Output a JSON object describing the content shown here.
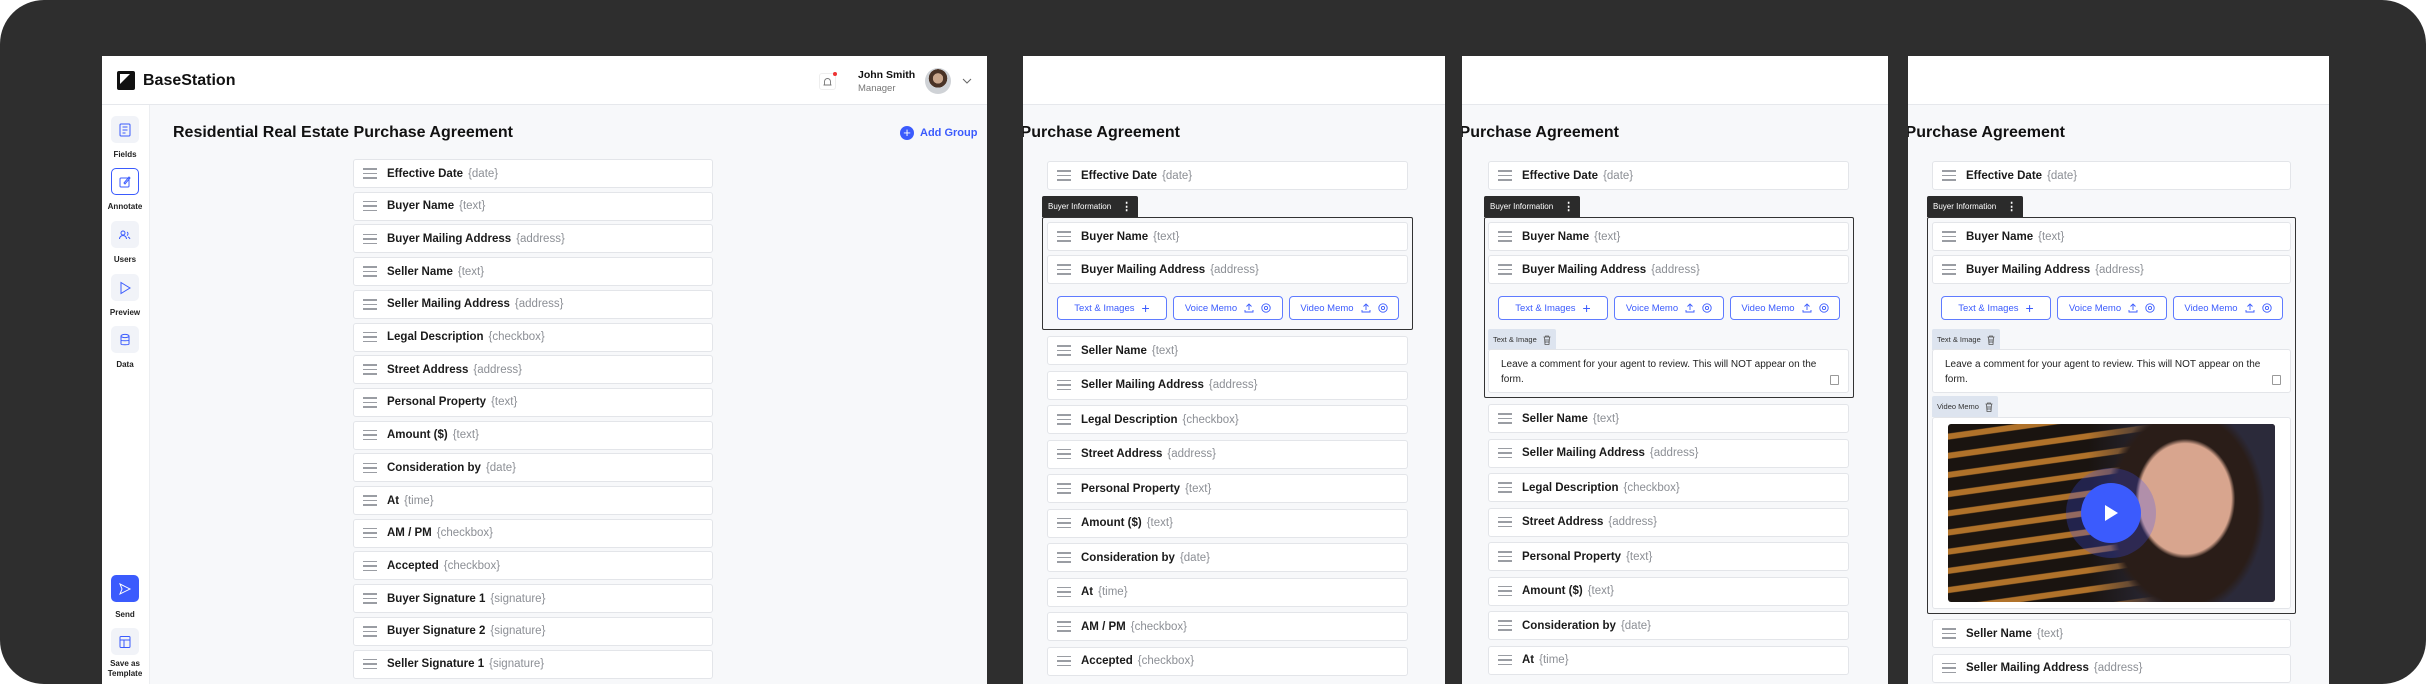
{
  "app": {
    "name": "BaseStation"
  },
  "user": {
    "name": "John Smith",
    "role": "Manager"
  },
  "sidebar": {
    "items": [
      {
        "label": "Fields",
        "icon": "document-icon"
      },
      {
        "label": "Annotate",
        "icon": "edit-icon",
        "selected": true
      },
      {
        "label": "Users",
        "icon": "users-icon"
      },
      {
        "label": "Preview",
        "icon": "play-icon"
      },
      {
        "label": "Data",
        "icon": "database-icon"
      }
    ],
    "send": {
      "label": "Send"
    },
    "template": {
      "label1": "Save as",
      "label2": "Template"
    }
  },
  "page": {
    "title": "Residential Real Estate Purchase Agreement",
    "add_group": "Add Group"
  },
  "fields": [
    {
      "label": "Effective Date",
      "type": "{date}"
    },
    {
      "label": "Buyer Name",
      "type": "{text}"
    },
    {
      "label": "Buyer Mailing Address",
      "type": "{address}"
    },
    {
      "label": "Seller Name",
      "type": "{text}"
    },
    {
      "label": "Seller Mailing Address",
      "type": "{address}"
    },
    {
      "label": "Legal Description",
      "type": "{checkbox}"
    },
    {
      "label": "Street Address",
      "type": "{address}"
    },
    {
      "label": "Personal Property",
      "type": "{text}"
    },
    {
      "label": "Amount ($)",
      "type": "{text}"
    },
    {
      "label": "Consideration by",
      "type": "{date}"
    },
    {
      "label": "At",
      "type": "{time}"
    },
    {
      "label": "AM / PM",
      "type": "{checkbox}"
    },
    {
      "label": "Accepted",
      "type": "{checkbox}"
    },
    {
      "label": "Buyer Signature 1",
      "type": "{signature}"
    },
    {
      "label": "Buyer Signature 2",
      "type": "{signature}"
    },
    {
      "label": "Seller Signature 1",
      "type": "{signature}"
    }
  ],
  "group": {
    "name": "Buyer Information",
    "buttons": [
      {
        "label": "Text & Images"
      },
      {
        "label": "Voice Memo"
      },
      {
        "label": "Video Memo"
      }
    ],
    "text_image_tab": "Text & Image",
    "comment": "Leave a comment for your agent to review. This will NOT appear on the form.",
    "video_tab": "Video Memo"
  },
  "colors": {
    "accent": "#3b5bfd",
    "frame": "#2e2e2e",
    "group_tab": "#2b2b2b"
  }
}
